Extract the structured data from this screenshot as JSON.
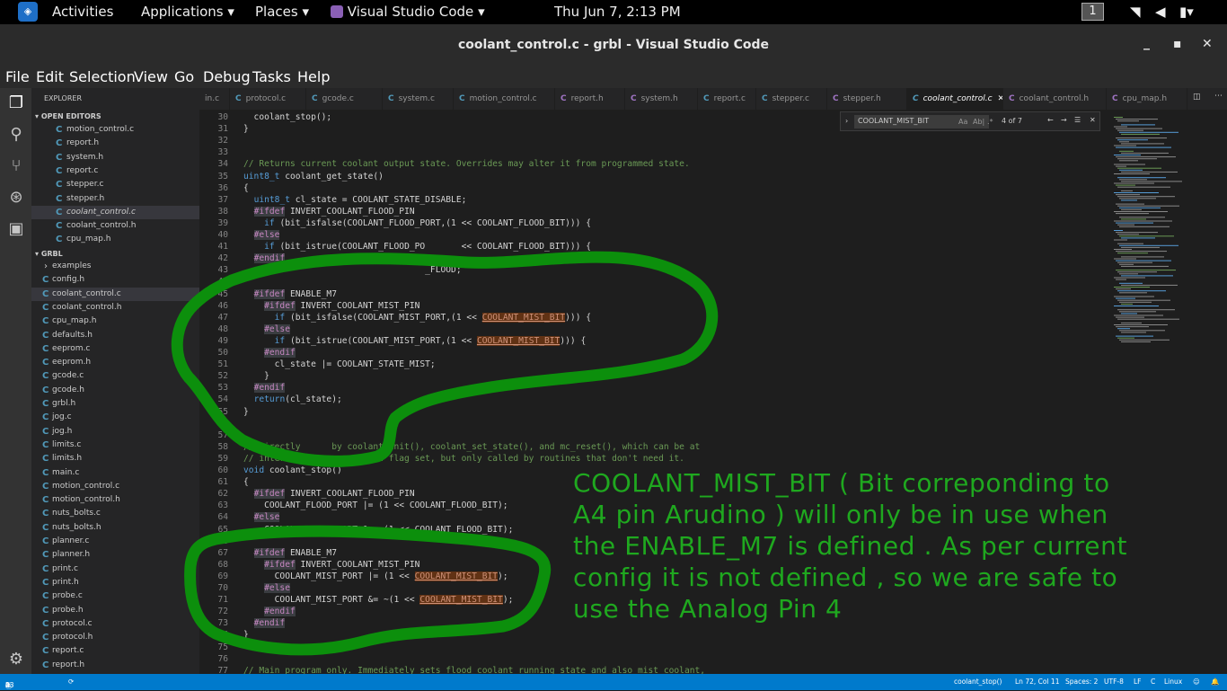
{
  "topbar": {
    "activities": "Activities",
    "applications": "Applications",
    "places": "Places",
    "app_name": "Visual Studio Code",
    "clock": "Thu Jun  7,  2:13 PM",
    "workspace": "1"
  },
  "window": {
    "title": "coolant_control.c - grbl - Visual Studio Code"
  },
  "menu": [
    "File",
    "Edit",
    "Selection",
    "View",
    "Go",
    "Debug",
    "Tasks",
    "Help"
  ],
  "explorer": {
    "title": "EXPLORER",
    "open_editors_label": "OPEN EDITORS",
    "open_editors": [
      "motion_control.c",
      "report.h",
      "system.h",
      "report.c",
      "stepper.c",
      "stepper.h",
      "coolant_control.c",
      "coolant_control.h",
      "cpu_map.h"
    ],
    "folder_label": "GRBL",
    "files": [
      "examples",
      "config.h",
      "coolant_control.c",
      "coolant_control.h",
      "cpu_map.h",
      "defaults.h",
      "eeprom.c",
      "eeprom.h",
      "gcode.c",
      "gcode.h",
      "grbl.h",
      "jog.c",
      "jog.h",
      "limits.c",
      "limits.h",
      "main.c",
      "motion_control.c",
      "motion_control.h",
      "nuts_bolts.c",
      "nuts_bolts.h",
      "planner.c",
      "planner.h",
      "print.c",
      "print.h",
      "probe.c",
      "probe.h",
      "protocol.c",
      "protocol.h",
      "report.c",
      "report.h"
    ]
  },
  "tabs": [
    "in.c",
    "protocol.c",
    "gcode.c",
    "system.c",
    "motion_control.c",
    "report.h",
    "system.h",
    "report.c",
    "stepper.c",
    "stepper.h",
    "coolant_control.c",
    "coolant_control.h",
    "cpu_map.h"
  ],
  "find": {
    "query": "COOLANT_MIST_BIT",
    "case_label": "Aa",
    "word_label": "Ab|",
    "result": "4 of 7"
  },
  "code": [
    {
      "n": "30",
      "t": "  coolant_stop();"
    },
    {
      "n": "31",
      "t": "}"
    },
    {
      "n": "32",
      "t": ""
    },
    {
      "n": "33",
      "t": ""
    },
    {
      "n": "34",
      "t": "// Returns current coolant output state. Overrides may alter it from programmed state."
    },
    {
      "n": "35",
      "t": "uint8_t coolant_get_state()"
    },
    {
      "n": "36",
      "t": "{"
    },
    {
      "n": "37",
      "t": "  uint8_t cl_state = COOLANT_STATE_DISABLE;"
    },
    {
      "n": "38",
      "t": "  #ifdef INVERT_COOLANT_FLOOD_PIN"
    },
    {
      "n": "39",
      "t": "    if (bit_isfalse(COOLANT_FLOOD_PORT,(1 << COOLANT_FLOOD_BIT))) {"
    },
    {
      "n": "40",
      "t": "  #else"
    },
    {
      "n": "41",
      "t": "    if (bit_istrue(COOLANT_FLOOD_PO       << COOLANT_FLOOD_BIT))) {"
    },
    {
      "n": "42",
      "t": "  #endif"
    },
    {
      "n": "43",
      "t": "                                   _FLOOD;"
    },
    {
      "n": "44",
      "t": ""
    },
    {
      "n": "45",
      "t": "  #ifdef ENABLE_M7"
    },
    {
      "n": "46",
      "t": "    #ifdef INVERT_COOLANT_MIST_PIN"
    },
    {
      "n": "47",
      "t": "      if (bit_isfalse(COOLANT_MIST_PORT,(1 << COOLANT_MIST_BIT))) {"
    },
    {
      "n": "48",
      "t": "    #else"
    },
    {
      "n": "49",
      "t": "      if (bit_istrue(COOLANT_MIST_PORT,(1 << COOLANT_MIST_BIT))) {"
    },
    {
      "n": "50",
      "t": "    #endif"
    },
    {
      "n": "51",
      "t": "      cl_state |= COOLANT_STATE_MIST;"
    },
    {
      "n": "52",
      "t": "    }"
    },
    {
      "n": "53",
      "t": "  #endif"
    },
    {
      "n": "54",
      "t": "  return(cl_state);"
    },
    {
      "n": "55",
      "t": "}"
    },
    {
      "n": "56",
      "t": ""
    },
    {
      "n": "57",
      "t": ""
    },
    {
      "n": "58",
      "t": "// Directly      by coolant_init(), coolant_set_state(), and mc_reset(), which can be at"
    },
    {
      "n": "59",
      "t": "// interrupt-le      report flag set, but only called by routines that don't need it."
    },
    {
      "n": "60",
      "t": "void coolant_stop()"
    },
    {
      "n": "61",
      "t": "{"
    },
    {
      "n": "62",
      "t": "  #ifdef INVERT_COOLANT_FLOOD_PIN"
    },
    {
      "n": "63",
      "t": "    COOLANT_FLOOD_PORT |= (1 << COOLANT_FLOOD_BIT);"
    },
    {
      "n": "64",
      "t": "  #else"
    },
    {
      "n": "65",
      "t": "    COOLANT_FLOOD_PORT &= ~(1 << COOLANT_FLOOD_BIT);"
    },
    {
      "n": "66",
      "t": ""
    },
    {
      "n": "67",
      "t": "  #ifdef ENABLE_M7"
    },
    {
      "n": "68",
      "t": "    #ifdef INVERT_COOLANT_MIST_PIN"
    },
    {
      "n": "69",
      "t": "      COOLANT_MIST_PORT |= (1 << COOLANT_MIST_BIT);"
    },
    {
      "n": "70",
      "t": "    #else"
    },
    {
      "n": "71",
      "t": "      COOLANT_MIST_PORT &= ~(1 << COOLANT_MIST_BIT);"
    },
    {
      "n": "72",
      "t": "    #endif"
    },
    {
      "n": "73",
      "t": "  #endif"
    },
    {
      "n": "74",
      "t": "}"
    },
    {
      "n": "75",
      "t": ""
    },
    {
      "n": "76",
      "t": ""
    },
    {
      "n": "77",
      "t": "// Main program only. Immediately sets flood coolant running state and also mist coolant,"
    }
  ],
  "annotation_lines": [
    "COOLANT_MIST_BIT  ( Bit correponding to",
    "A4 pin Arudino ) will only be in use when",
    "the ENABLE_M7 is defined . As per current",
    "config it is not defined , so we are safe to",
    "use the Analog Pin 4"
  ],
  "status": {
    "problems": "0",
    "warnings": "0",
    "info": "23",
    "scope": "coolant_stop()",
    "position": "Ln 72, Col 11",
    "spaces": "Spaces: 2",
    "encoding": "UTF-8",
    "eol": "LF",
    "language": "C",
    "os": "Linux"
  },
  "colors": {
    "status_bar": "#007acc",
    "annotation": "#1fa81f",
    "match": "#613214"
  }
}
